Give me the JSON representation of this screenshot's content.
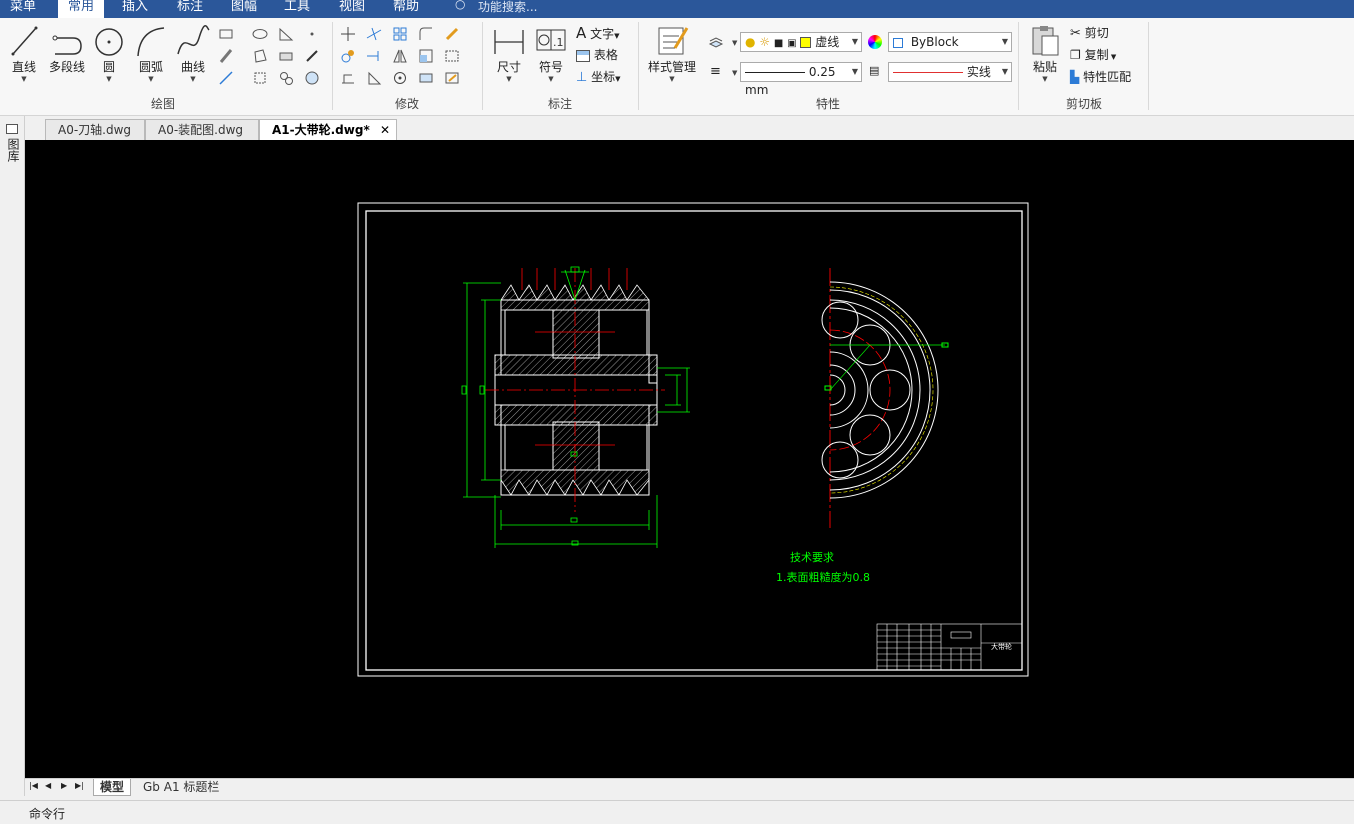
{
  "menubar": {
    "items": [
      "菜单",
      "常用",
      "插入",
      "标注",
      "图幅",
      "工具",
      "视图",
      "帮助"
    ],
    "active": "常用",
    "search_placeholder": "功能搜索..."
  },
  "ribbon": {
    "draw": {
      "label": "绘图",
      "line": "直线",
      "polyline": "多段线",
      "circle": "圆",
      "arc": "圆弧",
      "curve": "曲线"
    },
    "modify": {
      "label": "修改"
    },
    "annotate": {
      "label": "标注",
      "dimension": "尺寸",
      "symbol": "符号",
      "text": "文字",
      "table": "表格",
      "coordinate": "坐标"
    },
    "properties": {
      "label": "特性",
      "style_manager": "样式管理",
      "layer": "虚线",
      "color": "ByBlock",
      "lineweight": "0.25 mm",
      "linetype": "实线"
    },
    "clipboard": {
      "label": "剪切板",
      "paste": "粘贴",
      "cut": "剪切",
      "copy": "复制",
      "match": "特性匹配"
    }
  },
  "tabs": [
    {
      "label": "A0-刀轴.dwg",
      "active": false
    },
    {
      "label": "A0-装配图.dwg",
      "active": false
    },
    {
      "label": "A1-大带轮.dwg*",
      "active": true
    }
  ],
  "left_panel": {
    "label": "图库"
  },
  "drawing": {
    "notes_title": "技术要求",
    "notes_line1": "1.表面粗糙度为0.8",
    "title_block_name": "大带轮"
  },
  "layout_tabs": [
    "模型",
    "Gb A1 标题栏"
  ],
  "command_line": {
    "label": "命令行"
  },
  "colors": {
    "menubar": "#2b579a",
    "canvas": "#000000",
    "dim_green": "#00ff00",
    "center_red": "#ff0000",
    "outline_white": "#ffffff",
    "phantom_yellow": "#ffff00"
  }
}
